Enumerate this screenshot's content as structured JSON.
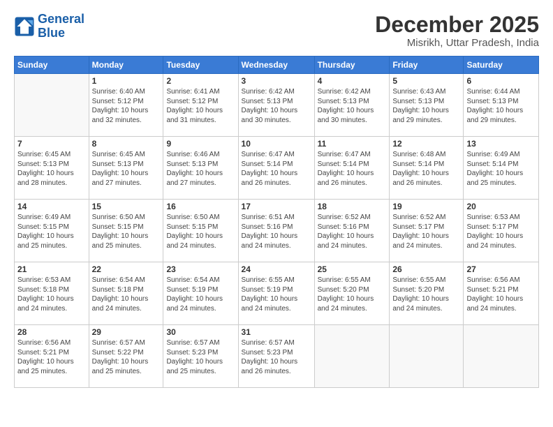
{
  "logo": {
    "line1": "General",
    "line2": "Blue"
  },
  "title": "December 2025",
  "location": "Misrikh, Uttar Pradesh, India",
  "weekdays": [
    "Sunday",
    "Monday",
    "Tuesday",
    "Wednesday",
    "Thursday",
    "Friday",
    "Saturday"
  ],
  "weeks": [
    [
      {
        "day": "",
        "info": ""
      },
      {
        "day": "1",
        "info": "Sunrise: 6:40 AM\nSunset: 5:12 PM\nDaylight: 10 hours\nand 32 minutes."
      },
      {
        "day": "2",
        "info": "Sunrise: 6:41 AM\nSunset: 5:12 PM\nDaylight: 10 hours\nand 31 minutes."
      },
      {
        "day": "3",
        "info": "Sunrise: 6:42 AM\nSunset: 5:13 PM\nDaylight: 10 hours\nand 30 minutes."
      },
      {
        "day": "4",
        "info": "Sunrise: 6:42 AM\nSunset: 5:13 PM\nDaylight: 10 hours\nand 30 minutes."
      },
      {
        "day": "5",
        "info": "Sunrise: 6:43 AM\nSunset: 5:13 PM\nDaylight: 10 hours\nand 29 minutes."
      },
      {
        "day": "6",
        "info": "Sunrise: 6:44 AM\nSunset: 5:13 PM\nDaylight: 10 hours\nand 29 minutes."
      }
    ],
    [
      {
        "day": "7",
        "info": "Sunrise: 6:45 AM\nSunset: 5:13 PM\nDaylight: 10 hours\nand 28 minutes."
      },
      {
        "day": "8",
        "info": "Sunrise: 6:45 AM\nSunset: 5:13 PM\nDaylight: 10 hours\nand 27 minutes."
      },
      {
        "day": "9",
        "info": "Sunrise: 6:46 AM\nSunset: 5:13 PM\nDaylight: 10 hours\nand 27 minutes."
      },
      {
        "day": "10",
        "info": "Sunrise: 6:47 AM\nSunset: 5:14 PM\nDaylight: 10 hours\nand 26 minutes."
      },
      {
        "day": "11",
        "info": "Sunrise: 6:47 AM\nSunset: 5:14 PM\nDaylight: 10 hours\nand 26 minutes."
      },
      {
        "day": "12",
        "info": "Sunrise: 6:48 AM\nSunset: 5:14 PM\nDaylight: 10 hours\nand 26 minutes."
      },
      {
        "day": "13",
        "info": "Sunrise: 6:49 AM\nSunset: 5:14 PM\nDaylight: 10 hours\nand 25 minutes."
      }
    ],
    [
      {
        "day": "14",
        "info": "Sunrise: 6:49 AM\nSunset: 5:15 PM\nDaylight: 10 hours\nand 25 minutes."
      },
      {
        "day": "15",
        "info": "Sunrise: 6:50 AM\nSunset: 5:15 PM\nDaylight: 10 hours\nand 25 minutes."
      },
      {
        "day": "16",
        "info": "Sunrise: 6:50 AM\nSunset: 5:15 PM\nDaylight: 10 hours\nand 24 minutes."
      },
      {
        "day": "17",
        "info": "Sunrise: 6:51 AM\nSunset: 5:16 PM\nDaylight: 10 hours\nand 24 minutes."
      },
      {
        "day": "18",
        "info": "Sunrise: 6:52 AM\nSunset: 5:16 PM\nDaylight: 10 hours\nand 24 minutes."
      },
      {
        "day": "19",
        "info": "Sunrise: 6:52 AM\nSunset: 5:17 PM\nDaylight: 10 hours\nand 24 minutes."
      },
      {
        "day": "20",
        "info": "Sunrise: 6:53 AM\nSunset: 5:17 PM\nDaylight: 10 hours\nand 24 minutes."
      }
    ],
    [
      {
        "day": "21",
        "info": "Sunrise: 6:53 AM\nSunset: 5:18 PM\nDaylight: 10 hours\nand 24 minutes."
      },
      {
        "day": "22",
        "info": "Sunrise: 6:54 AM\nSunset: 5:18 PM\nDaylight: 10 hours\nand 24 minutes."
      },
      {
        "day": "23",
        "info": "Sunrise: 6:54 AM\nSunset: 5:19 PM\nDaylight: 10 hours\nand 24 minutes."
      },
      {
        "day": "24",
        "info": "Sunrise: 6:55 AM\nSunset: 5:19 PM\nDaylight: 10 hours\nand 24 minutes."
      },
      {
        "day": "25",
        "info": "Sunrise: 6:55 AM\nSunset: 5:20 PM\nDaylight: 10 hours\nand 24 minutes."
      },
      {
        "day": "26",
        "info": "Sunrise: 6:55 AM\nSunset: 5:20 PM\nDaylight: 10 hours\nand 24 minutes."
      },
      {
        "day": "27",
        "info": "Sunrise: 6:56 AM\nSunset: 5:21 PM\nDaylight: 10 hours\nand 24 minutes."
      }
    ],
    [
      {
        "day": "28",
        "info": "Sunrise: 6:56 AM\nSunset: 5:21 PM\nDaylight: 10 hours\nand 25 minutes."
      },
      {
        "day": "29",
        "info": "Sunrise: 6:57 AM\nSunset: 5:22 PM\nDaylight: 10 hours\nand 25 minutes."
      },
      {
        "day": "30",
        "info": "Sunrise: 6:57 AM\nSunset: 5:23 PM\nDaylight: 10 hours\nand 25 minutes."
      },
      {
        "day": "31",
        "info": "Sunrise: 6:57 AM\nSunset: 5:23 PM\nDaylight: 10 hours\nand 26 minutes."
      },
      {
        "day": "",
        "info": ""
      },
      {
        "day": "",
        "info": ""
      },
      {
        "day": "",
        "info": ""
      }
    ]
  ]
}
